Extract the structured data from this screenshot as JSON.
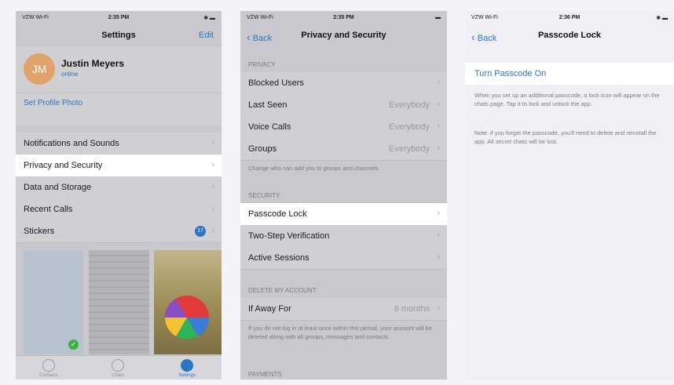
{
  "settings": {
    "status": {
      "carrier": "VZW Wi-Fi",
      "time": "2:35 PM",
      "battery": "✱ ▬"
    },
    "title": "Settings",
    "edit": "Edit",
    "profile": {
      "initials": "JM",
      "name": "Justin Meyers",
      "status": "online"
    },
    "set_photo": "Set Profile Photo",
    "items": [
      {
        "label": "Notifications and Sounds"
      },
      {
        "label": "Privacy and Security"
      },
      {
        "label": "Data and Storage"
      },
      {
        "label": "Recent Calls"
      },
      {
        "label": "Stickers",
        "badge": "17"
      }
    ],
    "tabs": [
      {
        "label": "Contacts"
      },
      {
        "label": "Chats"
      },
      {
        "label": "Settings"
      }
    ]
  },
  "privacy": {
    "status": {
      "carrier": "VZW Wi-Fi",
      "time": "2:35 PM",
      "battery": "▬"
    },
    "back": "Back",
    "title": "Privacy and Security",
    "privacy_header": "PRIVACY",
    "privacy_items": [
      {
        "label": "Blocked Users",
        "value": ""
      },
      {
        "label": "Last Seen",
        "value": "Everybody"
      },
      {
        "label": "Voice Calls",
        "value": "Everybody"
      },
      {
        "label": "Groups",
        "value": "Everybody"
      }
    ],
    "privacy_footer": "Change who can add you to groups and channels.",
    "security_header": "SECURITY",
    "security_items": [
      {
        "label": "Passcode Lock"
      },
      {
        "label": "Two-Step Verification"
      },
      {
        "label": "Active Sessions"
      }
    ],
    "delete_header": "DELETE MY ACCOUNT",
    "away": {
      "label": "If Away For",
      "value": "6 months"
    },
    "delete_footer": "If you do not log in at least once within this period, your account will be deleted along with all groups, messages and contacts.",
    "payments_header": "PAYMENTS"
  },
  "passcode": {
    "status": {
      "carrier": "VZW Wi-Fi",
      "time": "2:36 PM",
      "battery": "✱ ▬"
    },
    "back": "Back",
    "title": "Passcode Lock",
    "turn_on": "Turn Passcode On",
    "note1": "When you set up an additional passcode, a lock icon will appear on the chats page. Tap it to lock and unlock the app.",
    "note2": "Note: if you forget the passcode, you'll need to delete and reinstall the app. All secret chats will be lost."
  },
  "colors": {
    "accent": "#2a76c6",
    "avatar": "#e0a36a",
    "badge": "#2a76c6",
    "check": "#3cb043"
  }
}
